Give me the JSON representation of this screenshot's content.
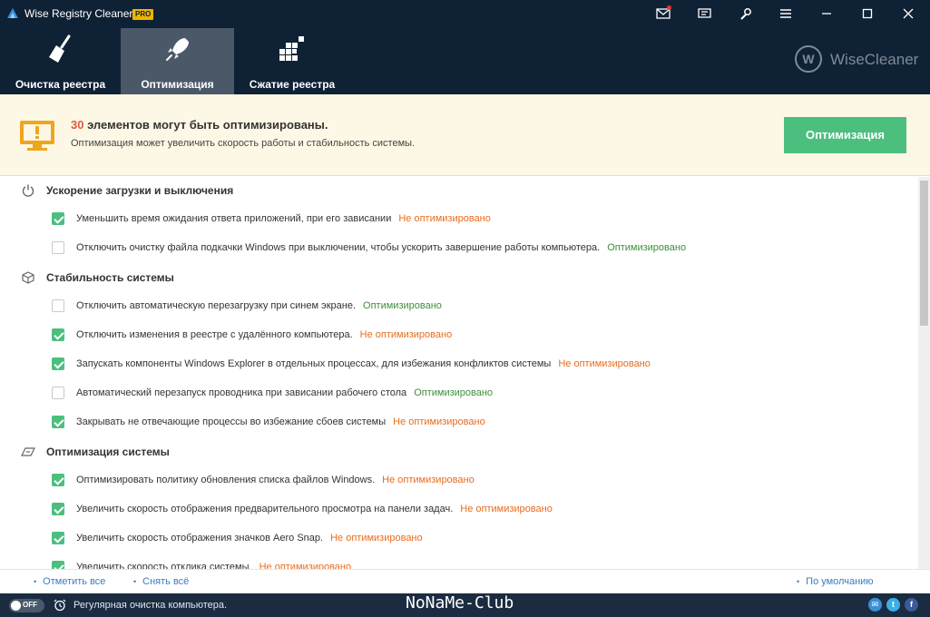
{
  "titlebar": {
    "app_title": "Wise Registry Cleaner X",
    "pro_badge": "PRO"
  },
  "tabs": [
    {
      "label": "Очистка реестра",
      "icon": "broom-icon"
    },
    {
      "label": "Оптимизация",
      "icon": "rocket-icon"
    },
    {
      "label": "Сжатие реестра",
      "icon": "blocks-icon"
    }
  ],
  "active_tab": 1,
  "brand": {
    "logo_letter": "W",
    "name": "WiseCleaner"
  },
  "banner": {
    "count": "30",
    "title_rest": " элементов могут быть оптимизированы.",
    "subtitle": "Оптимизация может увеличить скорость работы и стабильность системы.",
    "button": "Оптимизация"
  },
  "sections": [
    {
      "title": "Ускорение загрузки и выключения",
      "icon": "power-icon",
      "items": [
        {
          "text": "Уменьшить время ожидания ответа приложений, при его зависании",
          "status": "Не оптимизировано",
          "checked": true
        },
        {
          "text": "Отключить очистку файла подкачки Windows при выключении, чтобы ускорить завершение работы компьютера.",
          "status": "Оптимизировано",
          "checked": false
        }
      ]
    },
    {
      "title": "Стабильность системы",
      "icon": "cube-icon",
      "items": [
        {
          "text": "Отключить автоматическую перезагрузку при синем экране.",
          "status": "Оптимизировано",
          "checked": false
        },
        {
          "text": "Отключить изменения в реестре с удалённого компьютера.",
          "status": "Не оптимизировано",
          "checked": true
        },
        {
          "text": "Запускать компоненты Windows Explorer в отдельных процессах, для избежания конфликтов системы",
          "status": "Не оптимизировано",
          "checked": true
        },
        {
          "text": "Автоматический перезапуск проводника при зависании рабочего стола",
          "status": "Оптимизировано",
          "checked": false
        },
        {
          "text": "Закрывать не отвечающие процессы во избежание сбоев системы",
          "status": "Не оптимизировано",
          "checked": true
        }
      ]
    },
    {
      "title": "Оптимизация системы",
      "icon": "speed-icon",
      "items": [
        {
          "text": "Оптимизировать политику обновления списка файлов Windows.",
          "status": "Не оптимизировано",
          "checked": true
        },
        {
          "text": "Увеличить скорость отображения предварительного просмотра на панели задач.",
          "status": "Не оптимизировано",
          "checked": true
        },
        {
          "text": "Увеличить скорость отображения значков Aero Snap.",
          "status": "Не оптимизировано",
          "checked": true
        },
        {
          "text": "Увеличить скорость отклика системы.",
          "status": "Не оптимизировано",
          "checked": true
        }
      ]
    }
  ],
  "footer": {
    "select_all": "Отметить все",
    "deselect_all": "Снять всё",
    "default": "По умолчанию"
  },
  "statusbar": {
    "toggle": "OFF",
    "text": "Регулярная очистка компьютера.",
    "watermark": "NoNaMe-Club"
  },
  "colors": {
    "not_optimized": "#e86c1f",
    "optimized": "#3e8e3e",
    "accent_green": "#4cbf7f"
  }
}
